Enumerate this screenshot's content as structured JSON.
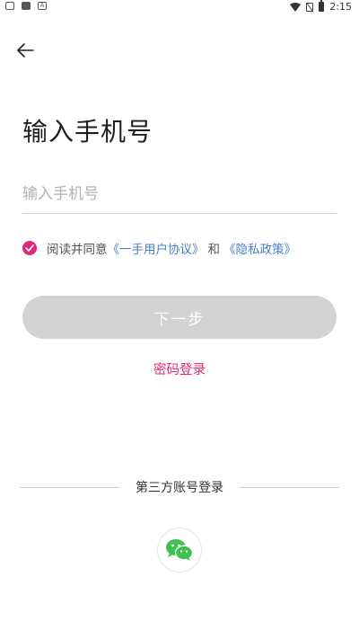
{
  "status_bar": {
    "time": "2:15",
    "left_icons": [
      "notification-icon",
      "app-icon",
      "a-icon"
    ],
    "right_icons": [
      "wifi-icon",
      "no-sim-icon",
      "battery-icon"
    ]
  },
  "header": {
    "back_icon": "arrow-left-icon"
  },
  "main": {
    "title": "输入手机号",
    "phone_placeholder": "输入手机号",
    "agreement": {
      "prefix": "阅读并同意",
      "user_agreement": "《一手用户协议》",
      "and": "和",
      "privacy_policy": "《隐私政策》",
      "checked": true
    },
    "next_button": "下一步",
    "password_login": "密码登录"
  },
  "third_party": {
    "label": "第三方账号登录",
    "wechat_icon": "wechat-icon"
  },
  "colors": {
    "accent": "#e0277b",
    "link": "#4a7fc8",
    "disabled_button": "#d4d2d4",
    "wechat_green": "#3ec150"
  }
}
